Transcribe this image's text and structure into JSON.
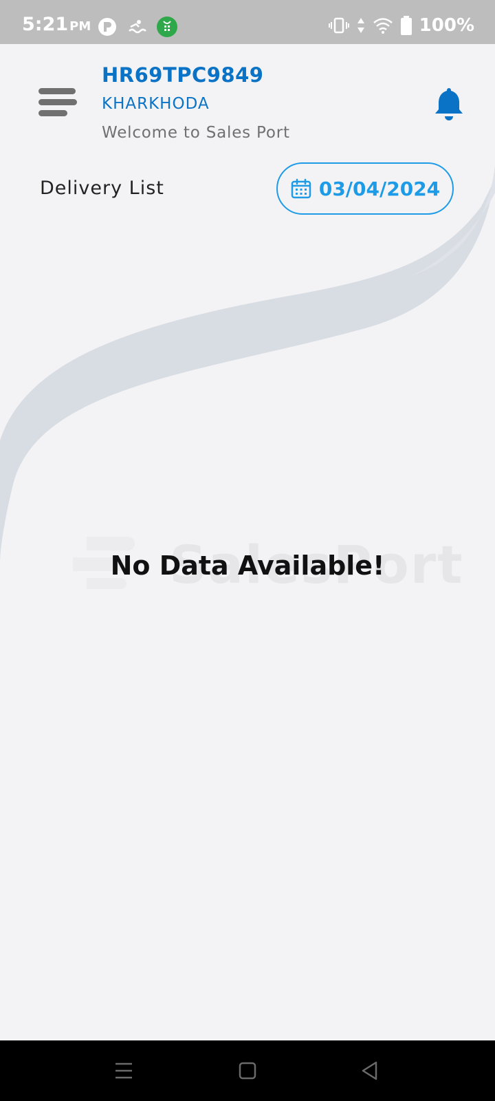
{
  "status_bar": {
    "time": "5:21",
    "ampm": "PM",
    "battery": "100%",
    "icons": [
      "app-icon-1",
      "app-icon-2",
      "app-icon-3",
      "vibrate-icon",
      "data-arrows-icon",
      "wifi-icon",
      "battery-icon"
    ]
  },
  "header": {
    "vehicle_number": "HR69TPC9849",
    "location": "KHARKHODA",
    "welcome": "Welcome to Sales Port"
  },
  "delivery": {
    "label": "Delivery List",
    "date": "03/04/2024"
  },
  "empty_state": {
    "message": "No Data Available!",
    "watermark": "SalesPort"
  },
  "colors": {
    "accent": "#0b73c6",
    "date_accent": "#1d9be6",
    "background": "#f3f3f5",
    "swoosh": "#d8dce3"
  },
  "nav_bar": {
    "icons": [
      "recent-apps-icon",
      "home-icon",
      "back-icon"
    ]
  }
}
